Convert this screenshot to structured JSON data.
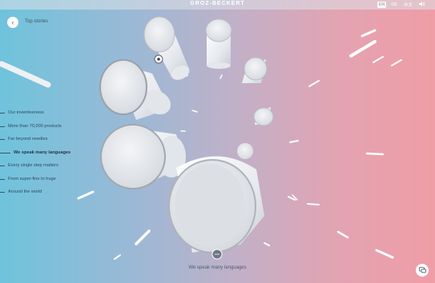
{
  "header": {
    "brand": "GROZ-BECKERT",
    "languages": [
      {
        "label": "EN",
        "active": true
      },
      {
        "label": "DE",
        "active": false
      },
      {
        "label": "中文",
        "active": false
      }
    ],
    "sound_icon": "speaker-icon"
  },
  "back": {
    "label": "Top stories",
    "icon": "chevron-left-icon"
  },
  "nav": {
    "items": [
      {
        "label": "Our inventiveness",
        "active": false
      },
      {
        "label": "More than 70,000 products",
        "active": false
      },
      {
        "label": "Far beyond needles",
        "active": false
      },
      {
        "label": "We speak many languages",
        "active": true
      },
      {
        "label": "Every single step matters",
        "active": false
      },
      {
        "label": "From super-fine to huge",
        "active": false
      },
      {
        "label": "Around the world",
        "active": false
      }
    ]
  },
  "caption": "We speak many languages",
  "chat": {
    "icon": "chat-icon"
  },
  "colors": {
    "gradient_left": "#6fc3dc",
    "gradient_right": "#ef9da6",
    "text_dark": "#2f4a5c"
  }
}
